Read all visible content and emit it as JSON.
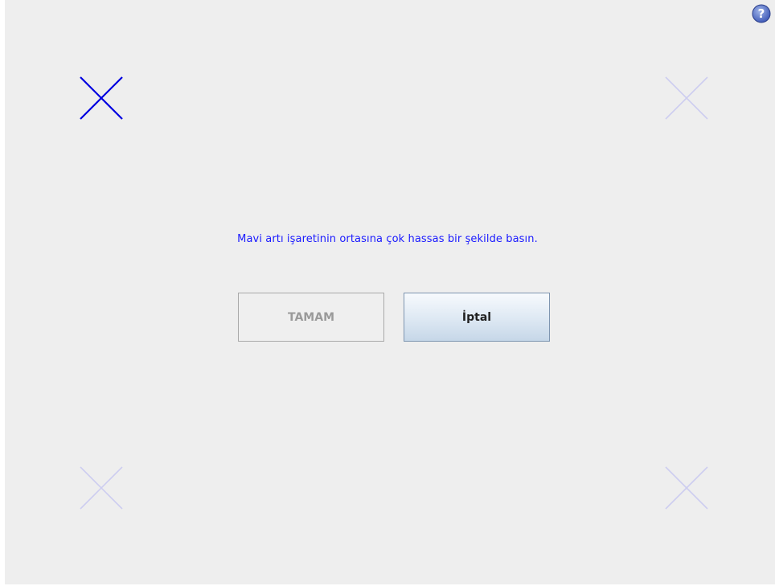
{
  "calibration": {
    "instruction": "Mavi artı işaretinin ortasına çok hassas bir şekilde basın.",
    "targets": [
      {
        "position": "top-left",
        "active": true
      },
      {
        "position": "top-right",
        "active": false
      },
      {
        "position": "bottom-left",
        "active": false
      },
      {
        "position": "bottom-right",
        "active": false
      }
    ]
  },
  "buttons": {
    "ok_label": "TAMAM",
    "ok_enabled": false,
    "cancel_label": "İptal"
  },
  "help": {
    "icon": "help-icon"
  },
  "colors": {
    "active_cross": "#0000e0",
    "inactive_cross": "#c8c8f0",
    "instruction_text": "#1a1aff",
    "background": "#eeeeee"
  }
}
